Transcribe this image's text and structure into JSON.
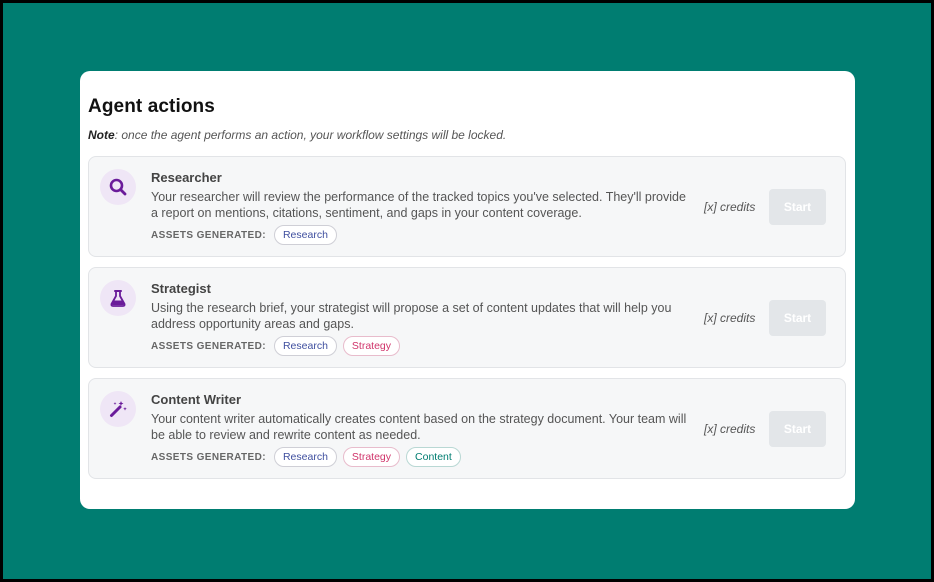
{
  "title": "Agent actions",
  "note": {
    "label": "Note",
    "text": ": once the agent performs an action, your workflow settings will be locked."
  },
  "assets_label": "ASSETS GENERATED",
  "assets_colon": ":",
  "agents": [
    {
      "name": "Researcher",
      "icon": "search-icon",
      "description": "Your researcher will review the performance of the tracked topics you've selected. They'll provide a report on mentions, citations, sentiment, and gaps in your content coverage.",
      "tags": [
        "Research"
      ],
      "credits": "[x] credits",
      "start": "Start"
    },
    {
      "name": "Strategist",
      "icon": "flask-icon",
      "description": "Using the research brief, your strategist will propose a set of content updates that will help you address opportunity areas and gaps.",
      "tags": [
        "Research",
        "Strategy"
      ],
      "credits": "[x] credits",
      "start": "Start"
    },
    {
      "name": "Content Writer",
      "icon": "magic-wand-icon",
      "description": "Your content writer automatically creates content based on the strategy document. Your team will be able to review and rewrite content as needed.",
      "tags": [
        "Research",
        "Strategy",
        "Content"
      ],
      "credits": "[x] credits",
      "start": "Start"
    }
  ],
  "colors": {
    "background": "#007d71",
    "icon_purple": "#6a1b9a",
    "research_tag": "#3f4f9f",
    "strategy_tag": "#d0356b",
    "content_tag": "#007d71"
  }
}
